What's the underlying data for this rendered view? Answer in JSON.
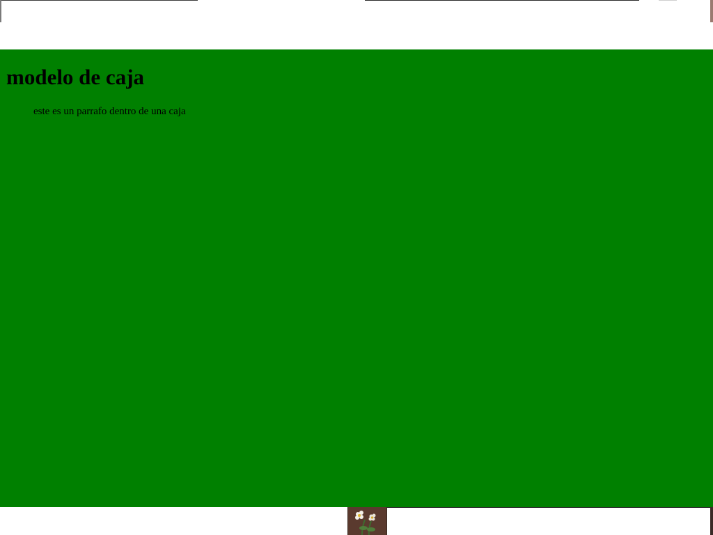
{
  "page": {
    "heading": "modelo de caja",
    "paragraph": "este es un parrafo dentro de una caja"
  },
  "colors": {
    "box_background": "#008000",
    "page_background": "#ffffff",
    "text": "#000000"
  },
  "icons": {
    "taskbar_thumbnail": "flower-plant-icon"
  }
}
